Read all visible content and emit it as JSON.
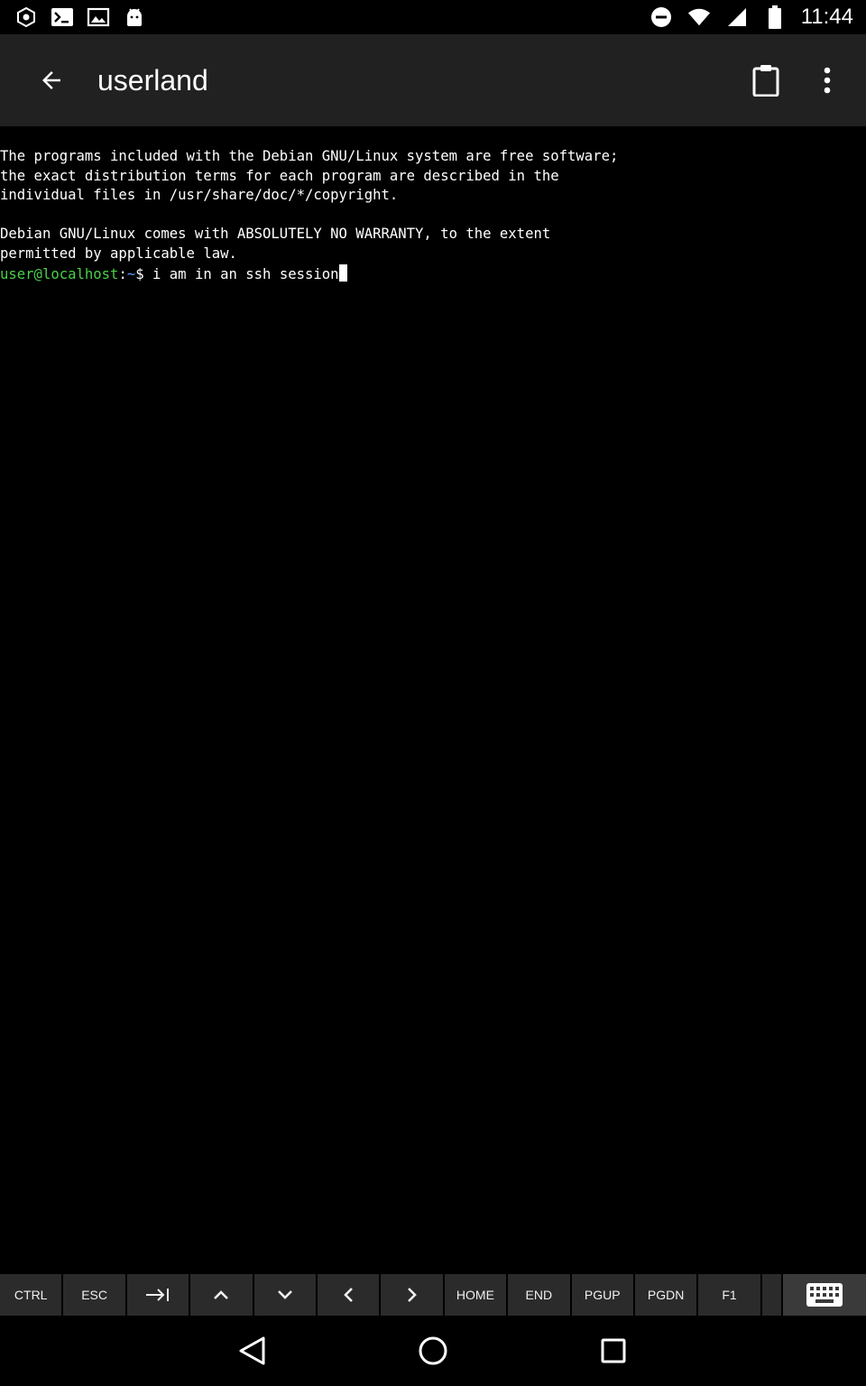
{
  "status_bar": {
    "left_icons": [
      "settings-hexagon-icon",
      "terminal-icon",
      "image-icon",
      "android-icon"
    ],
    "right_icons": [
      "do-not-disturb-icon",
      "wifi-icon",
      "cellular-icon",
      "battery-icon"
    ],
    "time": "11:44"
  },
  "app_bar": {
    "title": "userland",
    "back_icon": "arrow-back-icon",
    "actions": [
      "clipboard-icon",
      "more-vert-icon"
    ]
  },
  "terminal": {
    "lines": [
      "The programs included with the Debian GNU/Linux system are free software;",
      "the exact distribution terms for each program are described in the",
      "individual files in /usr/share/doc/*/copyright.",
      "",
      "Debian GNU/Linux comes with ABSOLUTELY NO WARRANTY, to the extent",
      "permitted by applicable law."
    ],
    "prompt_user": "user@localhost",
    "prompt_sep": ":",
    "prompt_path": "~",
    "prompt_symbol": "$ ",
    "command": "i am in an ssh session",
    "colors": {
      "user": "#4ad04a",
      "path": "#5f9bff",
      "text": "#ffffff"
    }
  },
  "extra_keys": {
    "ctrl": "CTRL",
    "esc": "ESC",
    "tab_icon": "tab-icon",
    "up_icon": "chevron-up-icon",
    "down_icon": "chevron-down-icon",
    "left_icon": "chevron-left-icon",
    "right_icon": "chevron-right-icon",
    "home": "HOME",
    "end": "END",
    "pgup": "PGUP",
    "pgdn": "PGDN",
    "f1": "F1",
    "keyboard_icon": "keyboard-icon"
  },
  "nav_bar": {
    "icons": [
      "back-triangle-icon",
      "home-circle-icon",
      "recents-square-icon"
    ]
  }
}
